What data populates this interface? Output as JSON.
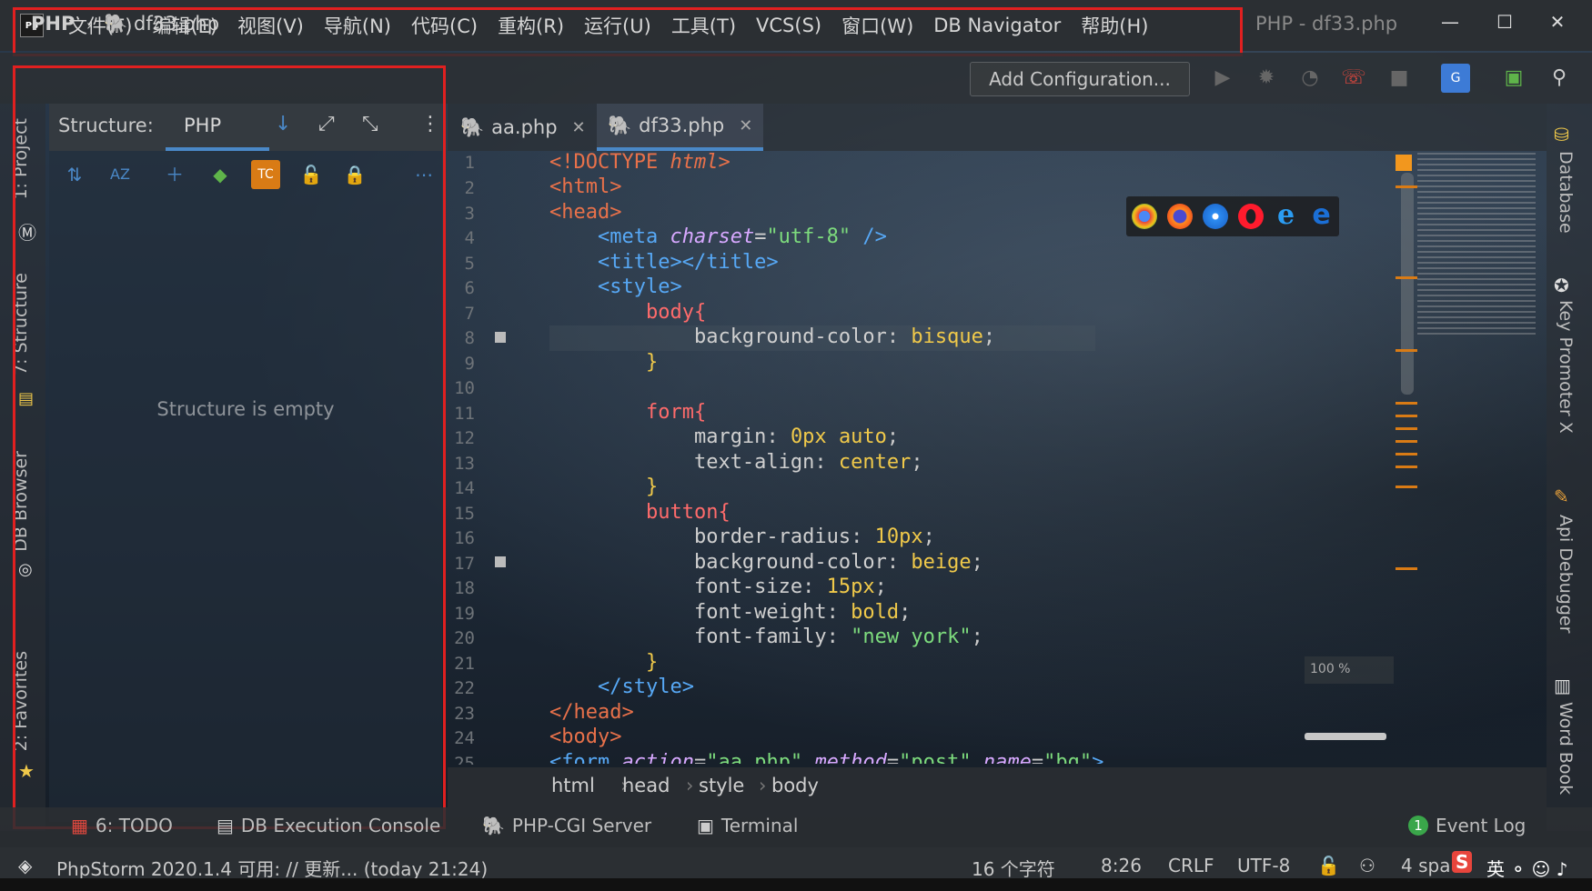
{
  "menubar": {
    "logo": "PS",
    "items": [
      "文件(F)",
      "编辑(E)",
      "视图(V)",
      "导航(N)",
      "代码(C)",
      "重构(R)",
      "运行(U)",
      "工具(T)",
      "VCS(S)",
      "窗口(W)",
      "DB Navigator",
      "帮助(H)"
    ],
    "window_title": "PHP - df33.php"
  },
  "navbar": {
    "root": "PHP",
    "sep": "›",
    "file": "df33.php",
    "add_config": "Add Configuration..."
  },
  "left_tabs": [
    "1: Project",
    "7: Structure",
    "DB Browser",
    "2: Favorites"
  ],
  "right_tabs": [
    "Database",
    "Key Promoter X",
    "Api Debugger",
    "Word Book"
  ],
  "structure": {
    "title": "Structure:",
    "tab": "PHP",
    "empty": "Structure is empty"
  },
  "editor_tabs": [
    {
      "label": "aa.php"
    },
    {
      "label": "df33.php"
    }
  ],
  "line_numbers": [
    "1",
    "2",
    "3",
    "4",
    "5",
    "6",
    "7",
    "8",
    "9",
    "10",
    "11",
    "12",
    "13",
    "14",
    "15",
    "16",
    "17",
    "18",
    "19",
    "20",
    "21",
    "22",
    "23",
    "24",
    "25"
  ],
  "zoom": "100 %",
  "editor_breadcrumb": [
    "html",
    "head",
    "style",
    "body"
  ],
  "bottom_tools": [
    "6: TODO",
    "DB Execution Console",
    "PHP-CGI Server",
    "Terminal"
  ],
  "event_log": {
    "count": "1",
    "label": "Event Log"
  },
  "status": {
    "message": "PhpStorm 2020.1.4 可用: // 更新... (today 21:24)",
    "chars": "16 个字符",
    "position": "8:26",
    "line_sep": "CRLF",
    "encoding": "UTF-8",
    "indent": "4 spa"
  },
  "colors": {
    "accent": "#4a88c7",
    "highlight_box": "#e02020"
  }
}
